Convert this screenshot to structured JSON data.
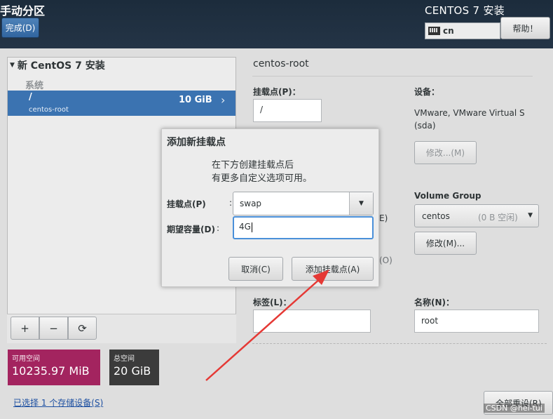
{
  "header": {
    "title": "手动分区",
    "done_button": "完成(D)",
    "product_title": "CENTOS 7 安装",
    "keyboard_layout": "cn",
    "help_button": "帮助！"
  },
  "tree": {
    "header": "新 CentOS 7 安装",
    "group_label": "系统",
    "rows": [
      {
        "mount": "/",
        "size": "10 GiB",
        "description": "centos-root"
      }
    ]
  },
  "toolbar": {
    "add": "+",
    "remove": "−",
    "refresh": "⟳"
  },
  "space": {
    "available_label": "可用空间",
    "available_value": "10235.97 MiB",
    "available_color": "#a3245f",
    "total_label": "总空间",
    "total_value": "20 GiB",
    "total_color": "#3b3b3b"
  },
  "storage_link": "已选择 1 个存储设备(S)",
  "detail": {
    "title": "centos-root",
    "mount_point_label": "挂载点(P)：",
    "mount_point_value": "/",
    "device_label": "设备：",
    "device_value": "VMware, VMware Virtual S (sda)",
    "modify_device_button": "修改...(M)",
    "volume_group_label": "Volume Group",
    "volume_group_value": "centos",
    "volume_group_free": "(0 B 空闲)",
    "modify_vg_button": "修改(M)...",
    "fragment_e": "E)",
    "fragment_o": "(O)",
    "label_label": "标签(L)：",
    "label_value": "",
    "name_label": "名称(N)：",
    "name_value": "root",
    "reset_all_button": "全部重设(R)"
  },
  "modal": {
    "title": "添加新挂载点",
    "description_line1": "在下方创建挂载点后",
    "description_line2": "有更多自定义选项可用。",
    "mount_point_label": "挂载点(P)",
    "mount_point_value": "swap",
    "capacity_label": "期望容量(D)",
    "capacity_value": "4G",
    "colon": ":",
    "cancel_button": "取消(C)",
    "add_button": "添加挂载点(A)"
  },
  "annotation": {
    "arrow_color": "#e53935"
  },
  "watermark": "CSDN @hei-tui",
  "colors": {
    "accent": "#3b73b1",
    "header_bg": "#1c2c3c",
    "focus": "#4a90d9"
  }
}
